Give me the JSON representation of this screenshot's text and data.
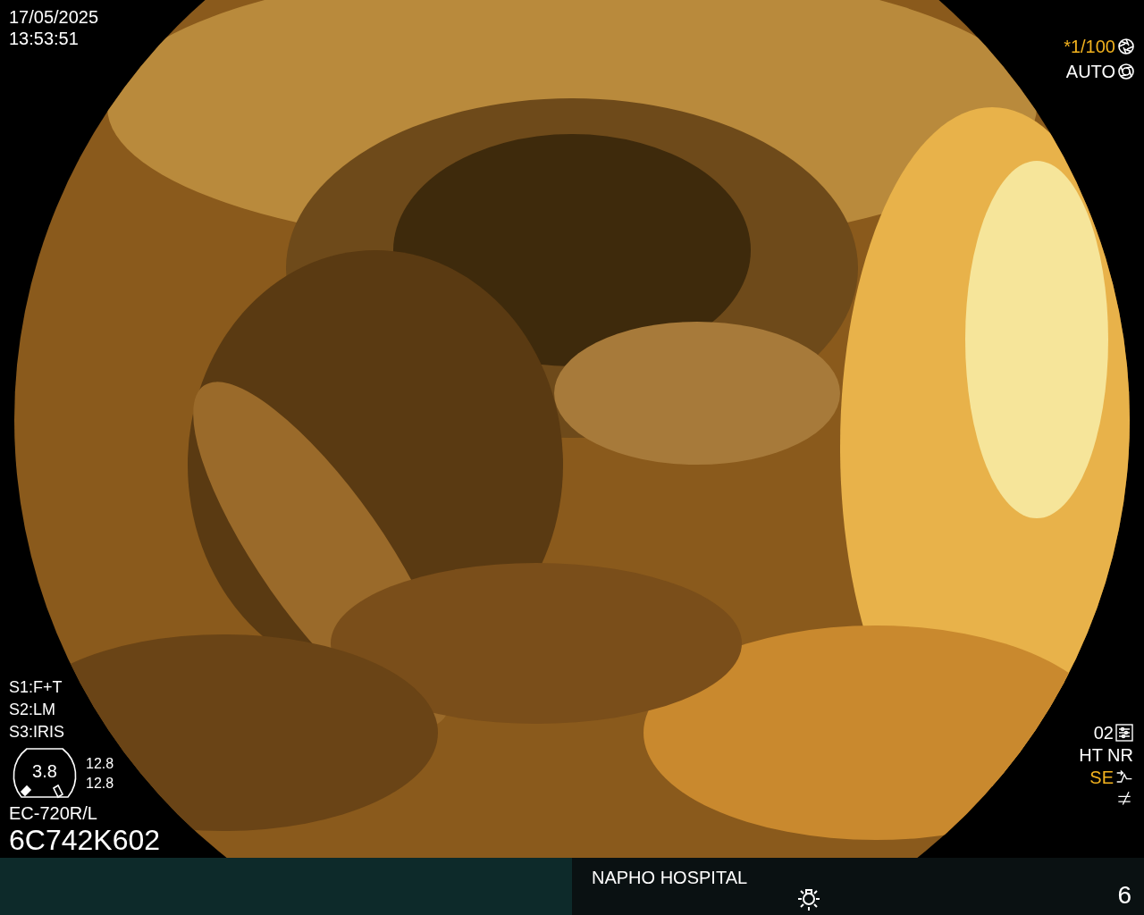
{
  "header": {
    "date": "17/05/2025",
    "time": "13:53:51"
  },
  "exposure": [
    {
      "text": "*1/100",
      "highlighted": true,
      "kind": "shutter"
    },
    {
      "text": "AUTO",
      "highlighted": false,
      "kind": "iris"
    }
  ],
  "switches": [
    "S1:F+T",
    "S2:LM",
    "S3:IRIS"
  ],
  "gauge": {
    "value": "3.8",
    "readings": [
      "12.8",
      "12.8"
    ]
  },
  "scope": {
    "model": "EC-720R/L",
    "serial": "6C742K602"
  },
  "enhancement": [
    {
      "text": "02",
      "highlighted": false,
      "kind": "preset"
    },
    {
      "text": "HT NR",
      "highlighted": false,
      "kind": "plain"
    },
    {
      "text": "SE",
      "highlighted": true,
      "kind": "curve"
    },
    {
      "highlighted": false,
      "kind": "slash"
    }
  ],
  "footer": {
    "hospital": "NAPHO HOSPITAL",
    "number": "6"
  }
}
